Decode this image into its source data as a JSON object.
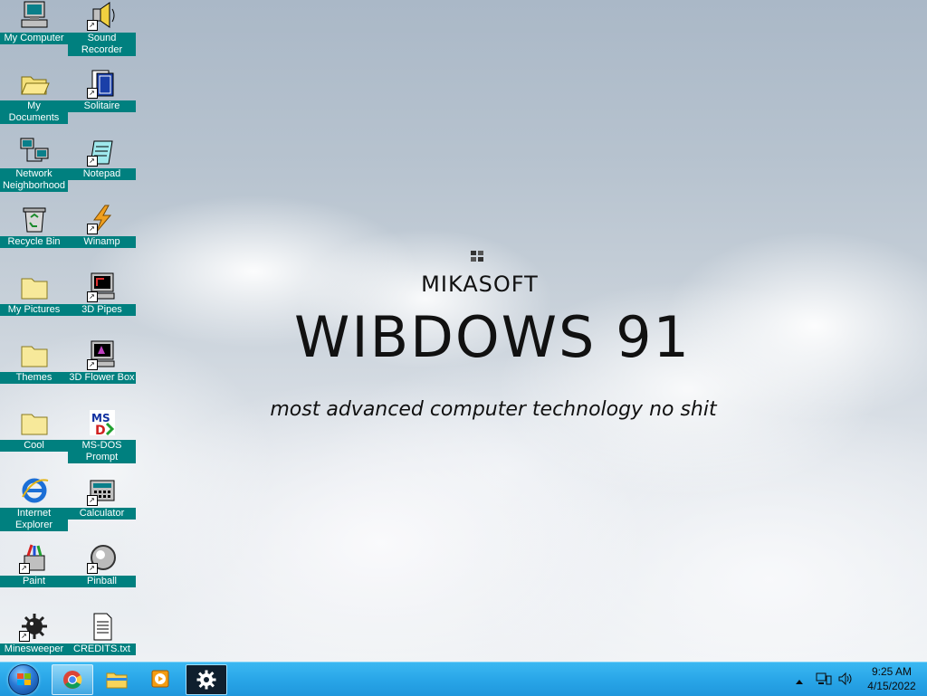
{
  "desktop": {
    "icons": [
      {
        "label": "My Computer",
        "icon": "my-computer-icon"
      },
      {
        "label": "Sound Recorder",
        "icon": "sound-recorder-icon"
      },
      {
        "label": "My Documents",
        "icon": "folder-open-icon"
      },
      {
        "label": "Solitaire",
        "icon": "solitaire-icon"
      },
      {
        "label": "Network Neighborhood",
        "icon": "network-icon"
      },
      {
        "label": "Notepad",
        "icon": "notepad-icon"
      },
      {
        "label": "Recycle Bin",
        "icon": "recycle-bin-icon"
      },
      {
        "label": "Winamp",
        "icon": "winamp-icon"
      },
      {
        "label": "My Pictures",
        "icon": "folder-icon"
      },
      {
        "label": "3D Pipes",
        "icon": "screensaver-icon"
      },
      {
        "label": "Themes",
        "icon": "folder-icon"
      },
      {
        "label": "3D Flower Box",
        "icon": "screensaver-icon"
      },
      {
        "label": "Cool",
        "icon": "folder-icon"
      },
      {
        "label": "MS-DOS Prompt",
        "icon": "ms-dos-icon"
      },
      {
        "label": "Internet Explorer",
        "icon": "internet-explorer-icon"
      },
      {
        "label": "Calculator",
        "icon": "calculator-icon"
      },
      {
        "label": "Paint",
        "icon": "paint-icon"
      },
      {
        "label": "Pinball",
        "icon": "pinball-icon"
      },
      {
        "label": "Minesweeper",
        "icon": "minesweeper-icon"
      },
      {
        "label": "CREDITS.txt",
        "icon": "text-file-icon"
      }
    ],
    "label_bg_color": "#00807f"
  },
  "splash": {
    "company": "MIKASOFT",
    "title": "WIBDOWS 91",
    "tagline": "most advanced computer technology no shit"
  },
  "taskbar": {
    "color": "#29a6e8",
    "items": [
      {
        "icon": "start-orb-icon"
      },
      {
        "icon": "chrome-icon"
      },
      {
        "icon": "file-explorer-icon"
      },
      {
        "icon": "media-player-icon"
      },
      {
        "icon": "gear-icon"
      }
    ],
    "tray": {
      "time": "9:25 AM",
      "date": "4/15/2022",
      "icons": [
        "chevron-up-icon",
        "network-icon",
        "volume-icon"
      ]
    }
  }
}
